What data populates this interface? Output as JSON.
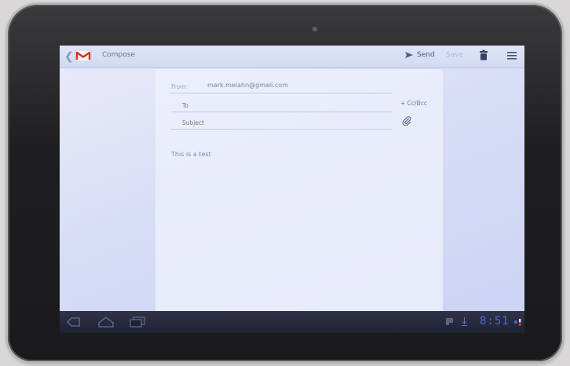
{
  "action_bar": {
    "title": "Compose",
    "send_label": "Send",
    "save_label": "Save"
  },
  "form": {
    "from_label": "From:",
    "from_value": "mark.melahn@gmail.com",
    "to_placeholder": "To",
    "subject_placeholder": "Subject",
    "cc_bcc_label": "+ Cc/Bcc",
    "body_text": "This is a test"
  },
  "status_bar": {
    "time": "8:51"
  },
  "icons": {
    "back": "chevron-left-icon",
    "app": "gmail-icon",
    "send": "send-icon",
    "trash": "trash-icon",
    "menu": "menu-icon",
    "attach": "paperclip-icon",
    "nav_back": "back-nav-icon",
    "nav_home": "home-icon",
    "nav_recent": "recent-apps-icon"
  },
  "colors": {
    "accent": "#4c6ae0",
    "gmail_red": "#d93025"
  }
}
